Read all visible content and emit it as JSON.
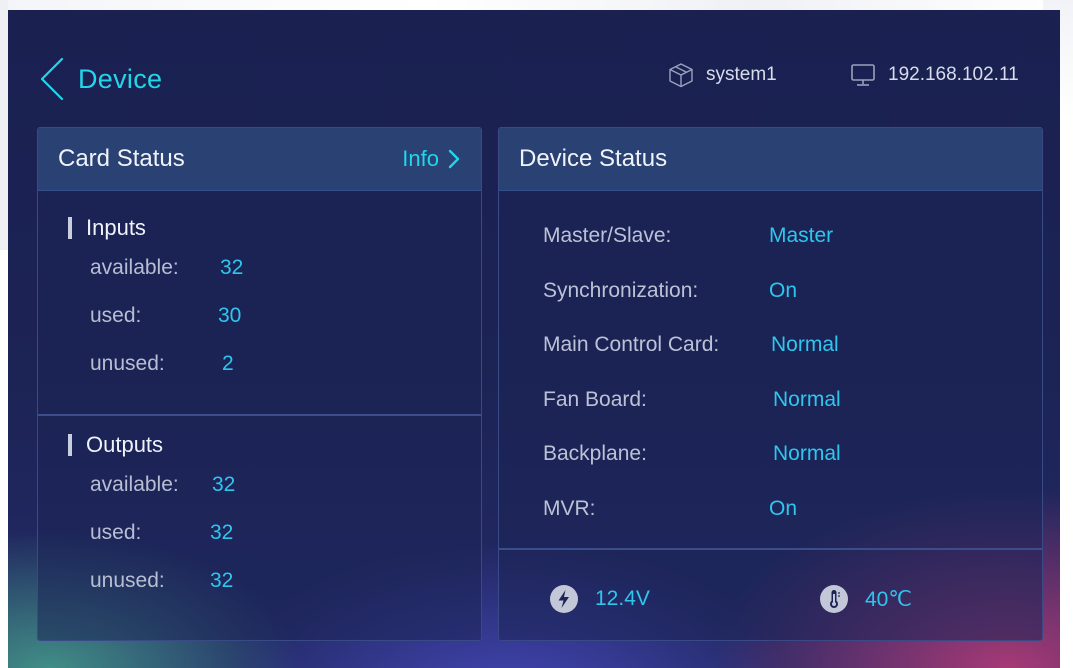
{
  "header": {
    "title": "Device",
    "system_name": "system1",
    "ip_address": "192.168.102.11"
  },
  "card_status": {
    "title": "Card Status",
    "info_label": "Info",
    "inputs": {
      "title": "Inputs",
      "rows": [
        {
          "label": "available:",
          "value": "32"
        },
        {
          "label": "used:",
          "value": "30"
        },
        {
          "label": "unused:",
          "value": "2"
        }
      ]
    },
    "outputs": {
      "title": "Outputs",
      "rows": [
        {
          "label": "available:",
          "value": "32"
        },
        {
          "label": "used:",
          "value": "32"
        },
        {
          "label": "unused:",
          "value": "32"
        }
      ]
    }
  },
  "device_status": {
    "title": "Device Status",
    "rows": [
      {
        "label": "Master/Slave:",
        "value": "Master"
      },
      {
        "label": "Synchronization:",
        "value": "On"
      },
      {
        "label": "Main Control Card:",
        "value": "Normal"
      },
      {
        "label": "Fan Board:",
        "value": "Normal"
      },
      {
        "label": "Backplane:",
        "value": "Normal"
      },
      {
        "label": "MVR:",
        "value": "On"
      }
    ],
    "voltage": "12.4V",
    "temperature": "40℃"
  },
  "icons": {
    "back": "chevron-left-icon",
    "system": "cube-icon",
    "ip": "monitor-icon",
    "info": "chevron-right-icon",
    "voltage": "lightning-icon",
    "temperature": "thermometer-icon"
  },
  "colors": {
    "accent": "#22d6ea",
    "value": "#2fc6ee",
    "background": "#1a2151",
    "panel_header": "#2a4173"
  }
}
